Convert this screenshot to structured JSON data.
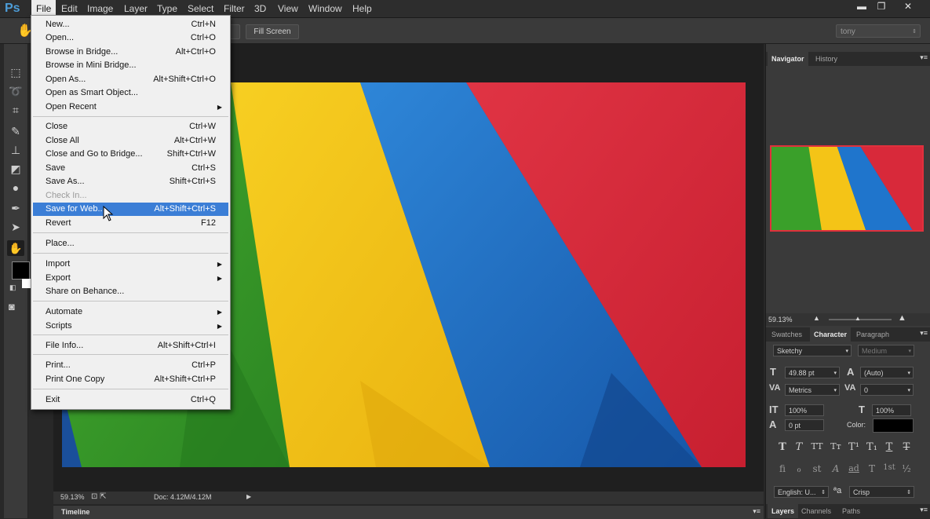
{
  "app": {
    "logo": "Ps"
  },
  "menubar": {
    "items": [
      "File",
      "Edit",
      "Image",
      "Layer",
      "Type",
      "Select",
      "Filter",
      "3D",
      "View",
      "Window",
      "Help"
    ]
  },
  "window_controls": {
    "minimize": "▬",
    "restore": "❐",
    "close": "✕"
  },
  "options_bar": {
    "fill_screen_label": "Fill Screen",
    "user_select_value": "tony"
  },
  "file_menu": {
    "items": [
      {
        "label": "New...",
        "shortcut": "Ctrl+N"
      },
      {
        "label": "Open...",
        "shortcut": "Ctrl+O"
      },
      {
        "label": "Browse in Bridge...",
        "shortcut": "Alt+Ctrl+O"
      },
      {
        "label": "Browse in Mini Bridge...",
        "shortcut": ""
      },
      {
        "label": "Open As...",
        "shortcut": "Alt+Shift+Ctrl+O"
      },
      {
        "label": "Open as Smart Object...",
        "shortcut": ""
      },
      {
        "label": "Open Recent",
        "shortcut": ""
      },
      {
        "label": "Close",
        "shortcut": "Ctrl+W"
      },
      {
        "label": "Close All",
        "shortcut": "Alt+Ctrl+W"
      },
      {
        "label": "Close and Go to Bridge...",
        "shortcut": "Shift+Ctrl+W"
      },
      {
        "label": "Save",
        "shortcut": "Ctrl+S"
      },
      {
        "label": "Save As...",
        "shortcut": "Shift+Ctrl+S"
      },
      {
        "label": "Check In...",
        "shortcut": ""
      },
      {
        "label": "Save for Web...",
        "shortcut": "Alt+Shift+Ctrl+S"
      },
      {
        "label": "Revert",
        "shortcut": "F12"
      },
      {
        "label": "Place...",
        "shortcut": ""
      },
      {
        "label": "Import",
        "shortcut": ""
      },
      {
        "label": "Export",
        "shortcut": ""
      },
      {
        "label": "Share on Behance...",
        "shortcut": ""
      },
      {
        "label": "Automate",
        "shortcut": ""
      },
      {
        "label": "Scripts",
        "shortcut": ""
      },
      {
        "label": "File Info...",
        "shortcut": "Alt+Shift+Ctrl+I"
      },
      {
        "label": "Print...",
        "shortcut": "Ctrl+P"
      },
      {
        "label": "Print One Copy",
        "shortcut": "Alt+Shift+Ctrl+P"
      },
      {
        "label": "Exit",
        "shortcut": "Ctrl+Q"
      }
    ]
  },
  "status_bar": {
    "zoom": "59.13%",
    "doc": "Doc: 4.12M/4.12M"
  },
  "timeline": {
    "label": "Timeline"
  },
  "navigator": {
    "tabs": [
      "Navigator",
      "History"
    ],
    "zoom": "59.13%"
  },
  "character": {
    "tabs": [
      "Swatches",
      "Character",
      "Paragraph"
    ],
    "font_family": "Sketchy",
    "font_style": "Medium",
    "font_size": "49.88 pt",
    "leading": "(Auto)",
    "kerning": "Metrics",
    "tracking": "0",
    "vertical_scale": "100%",
    "horizontal_scale": "100%",
    "baseline_shift": "0 pt",
    "color_label": "Color:",
    "type_style_glyphs": [
      "T",
      "T",
      "TT",
      "Tт",
      "T¹",
      "T₁",
      "T",
      "T"
    ],
    "opentype_glyphs": [
      "fi",
      "ℴ",
      "st",
      "A",
      "ad",
      "T",
      "1st",
      "½"
    ],
    "language": "English: U...",
    "aa_label": "ªa",
    "antialias": "Crisp"
  },
  "bottom_tabs": [
    "Layers",
    "Channels",
    "Paths"
  ],
  "colors": {
    "canvas_green": "#2f9a2a",
    "canvas_yellow": "#f4c417",
    "canvas_blue": "#1f6fc8",
    "canvas_red": "#d8293a",
    "highlight": "#3b7ed6"
  }
}
